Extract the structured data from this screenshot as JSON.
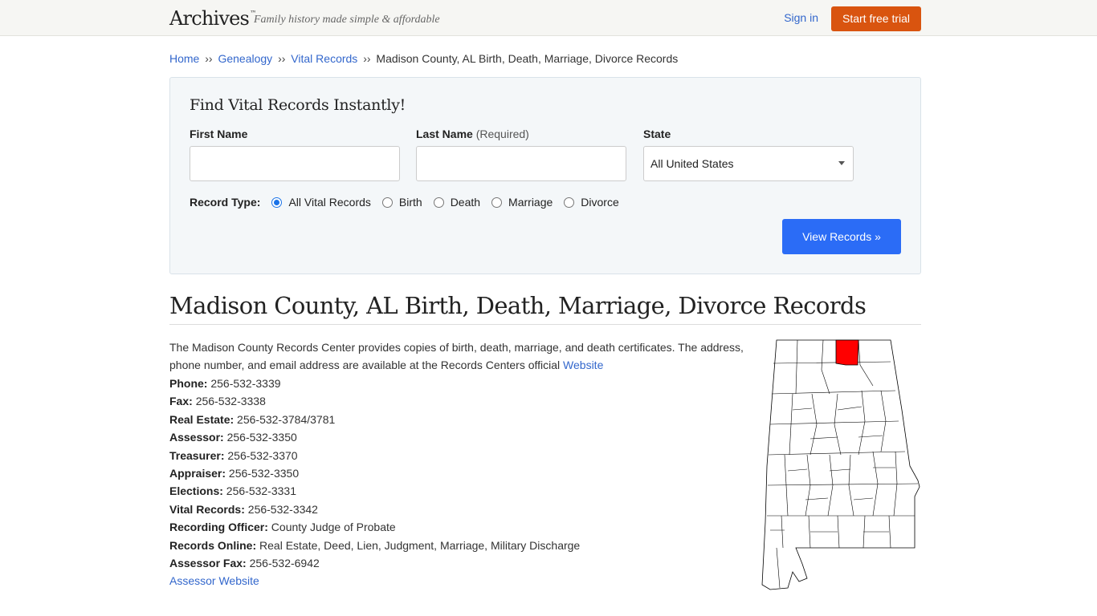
{
  "header": {
    "logo": "Archives",
    "logo_tm": "™",
    "tagline": "Family history made simple & affordable",
    "signin": "Sign in",
    "trial": "Start free trial"
  },
  "breadcrumb": {
    "items": [
      "Home",
      "Genealogy",
      "Vital Records"
    ],
    "separator": "››",
    "current": "Madison County, AL Birth, Death, Marriage, Divorce Records"
  },
  "search": {
    "title": "Find Vital Records Instantly!",
    "first_name_label": "First Name",
    "first_name_value": "",
    "last_name_label": "Last Name",
    "last_name_required": "(Required)",
    "last_name_value": "",
    "state_label": "State",
    "state_value": "All United States",
    "record_type_label": "Record Type:",
    "record_types": [
      "All Vital Records",
      "Birth",
      "Death",
      "Marriage",
      "Divorce"
    ],
    "selected_record_type": "All Vital Records",
    "submit": "View Records »"
  },
  "page_title": "Madison County, AL Birth, Death, Marriage, Divorce Records",
  "description": "The Madison County Records Center provides copies of birth, death, marriage, and death certificates. The address, phone number, and email address are available at the Records Centers official ",
  "description_link": "Website",
  "info": [
    {
      "label": "Phone:",
      "value": "256-532-3339"
    },
    {
      "label": "Fax:",
      "value": "256-532-3338"
    },
    {
      "label": "Real Estate:",
      "value": "256-532-3784/3781"
    },
    {
      "label": "Assessor:",
      "value": "256-532-3350"
    },
    {
      "label": "Treasurer:",
      "value": "256-532-3370"
    },
    {
      "label": "Appraiser:",
      "value": "256-532-3350"
    },
    {
      "label": "Elections:",
      "value": "256-532-3331"
    },
    {
      "label": "Vital Records:",
      "value": "256-532-3342"
    },
    {
      "label": "Recording Officer:",
      "value": "County Judge of Probate"
    },
    {
      "label": "Records Online:",
      "value": "Real Estate, Deed, Lien, Judgment, Marriage, Military Discharge"
    },
    {
      "label": "Assessor Fax:",
      "value": "256-532-6942"
    }
  ],
  "assessor_link": "Assessor Website",
  "map": {
    "highlight_color": "#ff0000",
    "outline_color": "#000000"
  },
  "colors": {
    "accent_orange": "#d9540f",
    "link_blue": "#3367cc",
    "button_blue": "#2b6cf6"
  }
}
